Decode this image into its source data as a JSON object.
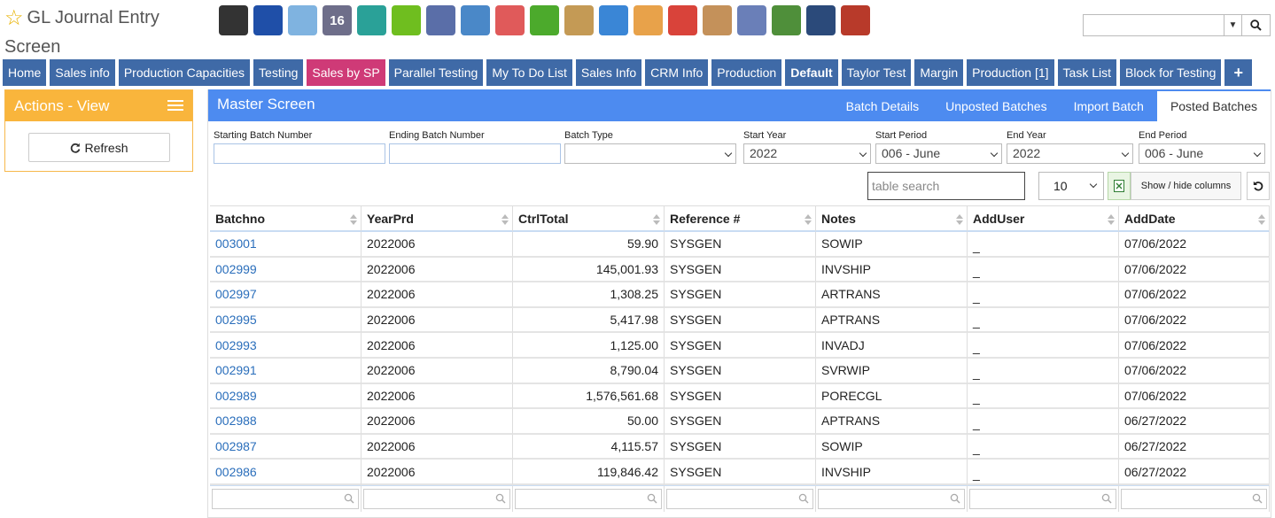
{
  "header": {
    "title_line1": "GL Journal Entry",
    "title_line2": "Screen",
    "calendar_day": "16",
    "search": {
      "value": "",
      "placeholder": ""
    }
  },
  "toolbar_icons": [
    {
      "name": "bank-icon",
      "color": "#333333"
    },
    {
      "name": "user-icon",
      "color": "#1f4fa8"
    },
    {
      "name": "weather-icon",
      "color": "#7fb3e0"
    },
    {
      "name": "calendar-icon",
      "color": "#6e6e8a"
    },
    {
      "name": "clock-icon",
      "color": "#2aa198"
    },
    {
      "name": "checkmark-icon",
      "color": "#6fbe1f"
    },
    {
      "name": "list-window-icon",
      "color": "#5a6ea8"
    },
    {
      "name": "magnifier-icon",
      "color": "#4a88c8"
    },
    {
      "name": "truck-icon",
      "color": "#e05a5a"
    },
    {
      "name": "basket-icon",
      "color": "#4caa2c"
    },
    {
      "name": "box-download-icon",
      "color": "#c49a55"
    },
    {
      "name": "box-upload-icon",
      "color": "#3a86d6"
    },
    {
      "name": "cash-hand-icon",
      "color": "#e8a24a"
    },
    {
      "name": "price-tag-icon",
      "color": "#d9433a"
    },
    {
      "name": "notepad-icon",
      "color": "#c4915a"
    },
    {
      "name": "pencil-icon",
      "color": "#6a7fb8"
    },
    {
      "name": "money-icon",
      "color": "#4f8f3a"
    },
    {
      "name": "safe-icon",
      "color": "#2b4a7a"
    },
    {
      "name": "warehouse-icon",
      "color": "#b83a2a"
    }
  ],
  "tabs": [
    {
      "label": "Home",
      "style": ""
    },
    {
      "label": "Sales info",
      "style": ""
    },
    {
      "label": "Production Capacities",
      "style": ""
    },
    {
      "label": "Testing",
      "style": ""
    },
    {
      "label": "Sales by SP",
      "style": "pink"
    },
    {
      "label": "Parallel Testing",
      "style": ""
    },
    {
      "label": "My To Do List",
      "style": ""
    },
    {
      "label": "Sales Info",
      "style": ""
    },
    {
      "label": "CRM Info",
      "style": ""
    },
    {
      "label": "Production",
      "style": ""
    },
    {
      "label": "Default",
      "style": "bold"
    },
    {
      "label": "Taylor Test",
      "style": ""
    },
    {
      "label": "Margin",
      "style": ""
    },
    {
      "label": "Production [1]",
      "style": ""
    },
    {
      "label": "Task List",
      "style": ""
    },
    {
      "label": "Block for Testing",
      "style": ""
    },
    {
      "label": "+",
      "style": "plus"
    }
  ],
  "actions": {
    "title": "Actions - View",
    "refresh_label": "Refresh"
  },
  "master": {
    "title": "Master Screen",
    "tabs": [
      "Batch Details",
      "Unposted Batches",
      "Import Batch",
      "Posted Batches"
    ],
    "active_tab": "Posted Batches",
    "filters": {
      "starting_batch": {
        "label": "Starting Batch Number",
        "value": ""
      },
      "ending_batch": {
        "label": "Ending Batch Number",
        "value": ""
      },
      "batch_type": {
        "label": "Batch Type",
        "value": ""
      },
      "start_year": {
        "label": "Start Year",
        "value": "2022"
      },
      "start_period": {
        "label": "Start Period",
        "value": "006 - June"
      },
      "end_year": {
        "label": "End Year",
        "value": "2022"
      },
      "end_period": {
        "label": "End Period",
        "value": "006 - June"
      }
    },
    "table_search_placeholder": "table search",
    "page_size": "10",
    "show_hide_label": "Show / hide columns"
  },
  "table": {
    "columns": [
      "Batchno",
      "YearPrd",
      "CtrlTotal",
      "Reference #",
      "Notes",
      "AddUser",
      "AddDate"
    ],
    "rows": [
      [
        "003001",
        "2022006",
        "59.90",
        "SYSGEN",
        "SOWIP",
        "_",
        "07/06/2022"
      ],
      [
        "002999",
        "2022006",
        "145,001.93",
        "SYSGEN",
        "INVSHIP",
        "_",
        "07/06/2022"
      ],
      [
        "002997",
        "2022006",
        "1,308.25",
        "SYSGEN",
        "ARTRANS",
        "_",
        "07/06/2022"
      ],
      [
        "002995",
        "2022006",
        "5,417.98",
        "SYSGEN",
        "APTRANS",
        "_",
        "07/06/2022"
      ],
      [
        "002993",
        "2022006",
        "1,125.00",
        "SYSGEN",
        "INVADJ",
        "_",
        "07/06/2022"
      ],
      [
        "002991",
        "2022006",
        "8,790.04",
        "SYSGEN",
        "SVRWIP",
        "_",
        "07/06/2022"
      ],
      [
        "002989",
        "2022006",
        "1,576,561.68",
        "SYSGEN",
        "PORECGL",
        "_",
        "07/06/2022"
      ],
      [
        "002988",
        "2022006",
        "50.00",
        "SYSGEN",
        "APTRANS",
        "_",
        "06/27/2022"
      ],
      [
        "002987",
        "2022006",
        "4,115.57",
        "SYSGEN",
        "SOWIP",
        "_",
        "06/27/2022"
      ],
      [
        "002986",
        "2022006",
        "119,846.42",
        "SYSGEN",
        "INVSHIP",
        "_",
        "06/27/2022"
      ]
    ]
  }
}
